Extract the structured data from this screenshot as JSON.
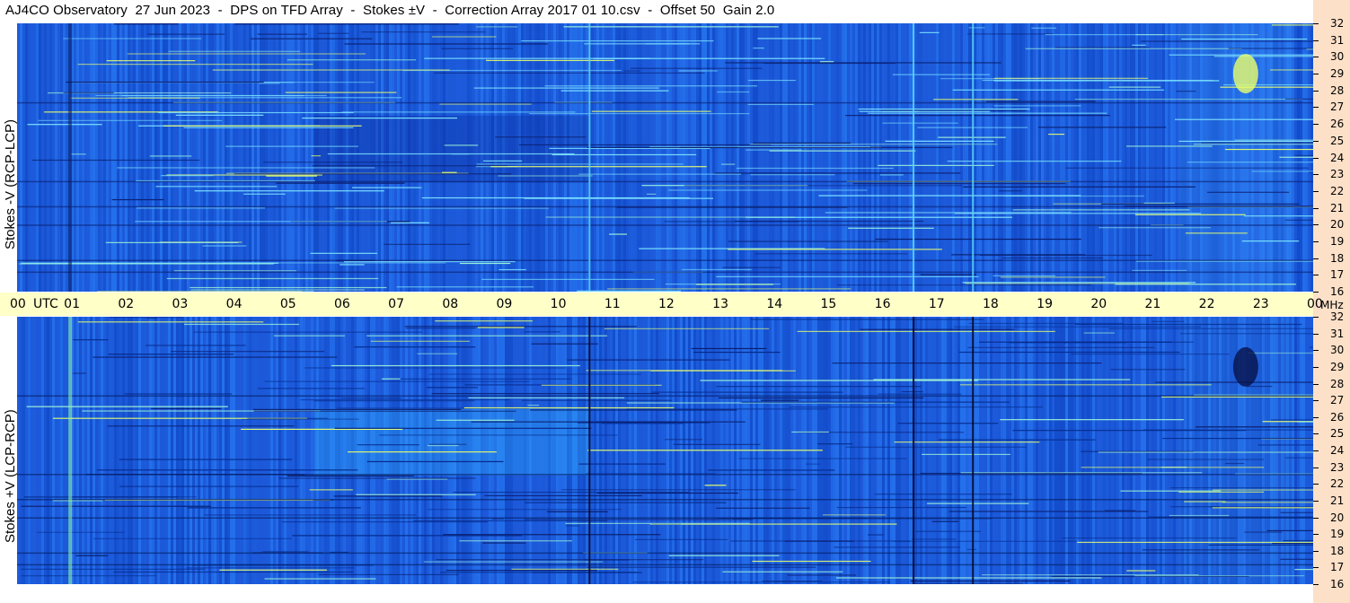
{
  "title": "AJ4CO Observatory  27 Jun 2023  -  DPS on TFD Array  -  Stokes ±V  -  Correction Array 2017 01 10.csv  -  Offset 50  Gain 2.0",
  "colors": {
    "panel_bg": "#1e5fe0",
    "time_axis_bg": "#ffffc8",
    "freq_strip_bg": "#fde0c8"
  },
  "chart_data": [
    {
      "type": "heatmap",
      "panel": "top",
      "ylabel": "Stokes -V (RCP-LCP)",
      "x_unit": "UTC",
      "x_ticks": [
        "00",
        "01",
        "02",
        "03",
        "04",
        "05",
        "06",
        "07",
        "08",
        "09",
        "10",
        "11",
        "12",
        "13",
        "14",
        "15",
        "16",
        "17",
        "18",
        "19",
        "20",
        "21",
        "22",
        "23",
        "00"
      ],
      "y_unit": "MHz",
      "y_ticks": [
        32,
        31,
        30,
        29,
        28,
        27,
        26,
        25,
        24,
        23,
        22,
        21,
        20,
        19,
        18,
        17,
        16
      ],
      "ylim": [
        16,
        32
      ],
      "xlim": [
        0,
        24
      ],
      "vertical_lines_utc": [
        10.6,
        16.6,
        17.7
      ],
      "bright_patch": {
        "utc": 22.75,
        "mhz": 29
      }
    },
    {
      "type": "heatmap",
      "panel": "bottom",
      "ylabel": "Stokes +V (LCP-RCP)",
      "x_unit": "UTC",
      "x_ticks": [
        "00",
        "01",
        "02",
        "03",
        "04",
        "05",
        "06",
        "07",
        "08",
        "09",
        "10",
        "11",
        "12",
        "13",
        "14",
        "15",
        "16",
        "17",
        "18",
        "19",
        "20",
        "21",
        "22",
        "23",
        "00"
      ],
      "y_unit": "MHz",
      "y_ticks": [
        32,
        31,
        30,
        29,
        28,
        27,
        26,
        25,
        24,
        23,
        22,
        21,
        20,
        19,
        18,
        17,
        16
      ],
      "ylim": [
        16,
        32
      ],
      "xlim": [
        0,
        24
      ],
      "vertical_lines_utc": [
        10.6,
        16.6,
        17.7
      ],
      "dark_patch": {
        "utc": 22.75,
        "mhz": 29
      }
    }
  ]
}
